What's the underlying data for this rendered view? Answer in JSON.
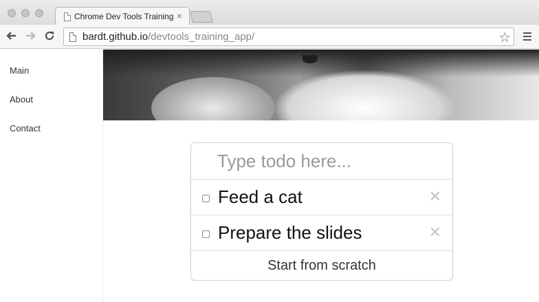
{
  "browser": {
    "tab_title": "Chrome Dev Tools Training",
    "tab_close": "×",
    "url_host": "bardt.github.io",
    "url_path": "/devtools_training_app/"
  },
  "sidebar": {
    "items": [
      {
        "label": "Main"
      },
      {
        "label": "About"
      },
      {
        "label": "Contact"
      }
    ]
  },
  "todo": {
    "placeholder": "Type todo here...",
    "items": [
      {
        "text": "Feed a cat",
        "done": false
      },
      {
        "text": "Prepare the slides",
        "done": false
      }
    ],
    "delete_symbol": "✕",
    "footer_label": "Start from scratch"
  },
  "icons": {
    "back": "arrow-left-icon",
    "forward": "arrow-right-icon",
    "reload": "reload-icon",
    "star": "star-icon",
    "menu": "hamburger-menu-icon"
  }
}
